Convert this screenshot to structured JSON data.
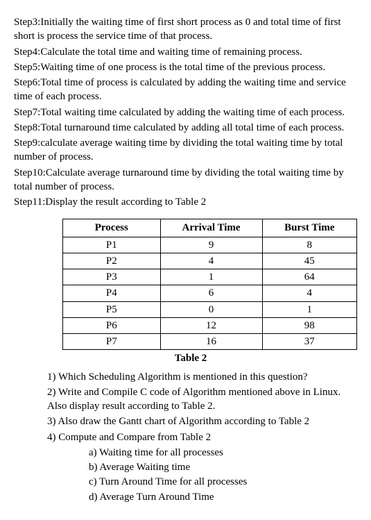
{
  "steps": [
    "Step3:Initially the waiting time of first short process as 0 and total time of first short is process the service time of that process.",
    "Step4:Calculate the total time and waiting time of remaining process.",
    "Step5:Waiting time of one process is the total time of the previous process.",
    "Step6:Total time of process is calculated by adding the waiting time and service time of each process.",
    "Step7:Total waiting time calculated by adding the waiting time of each process.",
    "Step8:Total turnaround time calculated by adding all total time of each process.",
    "Step9:calculate average waiting time by dividing the total waiting time by total number of process.",
    "Step10:Calculate average turnaround time by dividing the total waiting time by total number of process.",
    "Step11:Display the result according to Table 2"
  ],
  "table": {
    "headers": [
      "Process",
      "Arrival Time",
      "Burst Time"
    ],
    "rows": [
      [
        "P1",
        "9",
        "8"
      ],
      [
        "P2",
        "4",
        "45"
      ],
      [
        "P3",
        "1",
        "64"
      ],
      [
        "P4",
        "6",
        "4"
      ],
      [
        "P5",
        "0",
        "1"
      ],
      [
        "P6",
        "12",
        "98"
      ],
      [
        "P7",
        "16",
        "37"
      ]
    ],
    "caption": "Table 2"
  },
  "questions": [
    "1)  Which Scheduling Algorithm is mentioned in this question?",
    "2)  Write and Compile C code of Algorithm mentioned above in Linux. Also display result according to Table 2.",
    "3)  Also draw the Gantt chart of Algorithm according to Table 2",
    "4)  Compute and Compare from Table 2"
  ],
  "subquestions": [
    "a)   Waiting time for all processes",
    "b)   Average Waiting time",
    "c)   Turn Around Time for all processes",
    "d)   Average Turn Around Time"
  ],
  "chart_data": {
    "type": "table",
    "title": "Table 2",
    "columns": [
      "Process",
      "Arrival Time",
      "Burst Time"
    ],
    "data": [
      {
        "Process": "P1",
        "Arrival Time": 9,
        "Burst Time": 8
      },
      {
        "Process": "P2",
        "Arrival Time": 4,
        "Burst Time": 45
      },
      {
        "Process": "P3",
        "Arrival Time": 1,
        "Burst Time": 64
      },
      {
        "Process": "P4",
        "Arrival Time": 6,
        "Burst Time": 4
      },
      {
        "Process": "P5",
        "Arrival Time": 0,
        "Burst Time": 1
      },
      {
        "Process": "P6",
        "Arrival Time": 12,
        "Burst Time": 98
      },
      {
        "Process": "P7",
        "Arrival Time": 16,
        "Burst Time": 37
      }
    ]
  }
}
